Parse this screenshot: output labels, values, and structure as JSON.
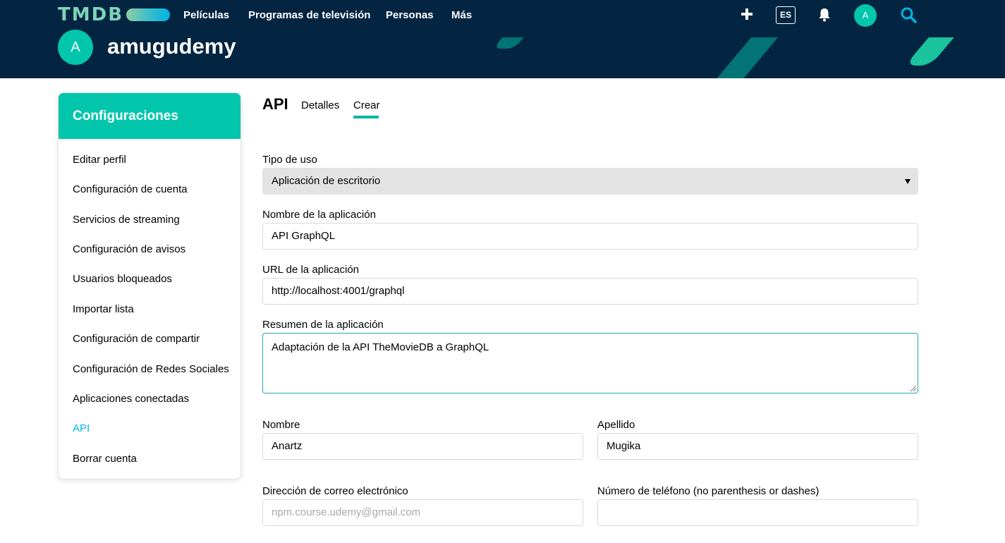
{
  "nav": {
    "logo": "TMDB",
    "links": [
      "Películas",
      "Programas de televisión",
      "Personas",
      "Más"
    ],
    "lang": "ES",
    "avatar_letter": "A",
    "icons": [
      "plus-icon",
      "bell-icon",
      "search-icon"
    ]
  },
  "profile": {
    "avatar_letter": "A",
    "username": "amugudemy"
  },
  "sidebar": {
    "title": "Configuraciones",
    "items": [
      {
        "label": "Editar perfil"
      },
      {
        "label": "Configuración de cuenta"
      },
      {
        "label": "Servicios de streaming"
      },
      {
        "label": "Configuración de avisos"
      },
      {
        "label": "Usuarios bloqueados"
      },
      {
        "label": "Importar lista"
      },
      {
        "label": "Configuración de compartir"
      },
      {
        "label": "Configuración de Redes Sociales"
      },
      {
        "label": "Aplicaciones conectadas"
      },
      {
        "label": "API"
      },
      {
        "label": "Borrar cuenta"
      }
    ],
    "active_item": "API"
  },
  "main": {
    "title": "API",
    "tabs": [
      {
        "label": "Detalles"
      },
      {
        "label": "Crear"
      }
    ],
    "active_tab": "Crear",
    "form": {
      "usage_type": {
        "label": "Tipo de uso",
        "value": "Aplicación de escritorio"
      },
      "app_name": {
        "label": "Nombre de la aplicación",
        "value": "API GraphQL"
      },
      "app_url": {
        "label": "URL de la aplicación",
        "value": "http://localhost:4001/graphql"
      },
      "app_summary": {
        "label": "Resumen de la aplicación",
        "value": "Adaptación de la API TheMovieDB a GraphQL"
      },
      "first_name": {
        "label": "Nombre",
        "value": "Anartz"
      },
      "last_name": {
        "label": "Apellido",
        "value": "Mugika"
      },
      "email": {
        "label": "Dirección de correo electrónico",
        "placeholder": "npm.course.udemy@gmail.com"
      },
      "phone": {
        "label": "Número de teléfono (no parenthesis or dashes)",
        "value": ""
      }
    }
  },
  "colors": {
    "navy": "#032541",
    "teal": "#01c6ac",
    "active_link": "#01b4e4"
  }
}
